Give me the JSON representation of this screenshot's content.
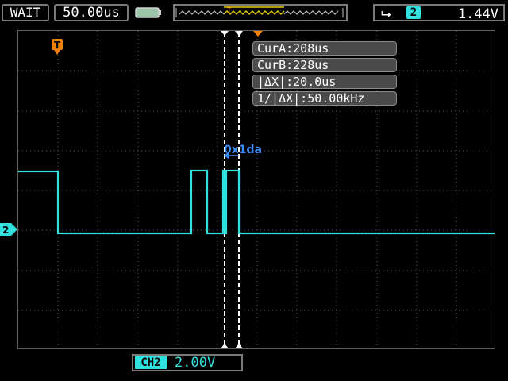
{
  "status": {
    "run_state": "WAIT",
    "timebase": "50.00us",
    "battery_icon": "battery-icon"
  },
  "trigger": {
    "slope_icon": "trigger-slope-icon",
    "source": "2",
    "level": "1.44V",
    "marker_label": "T"
  },
  "cursors": {
    "cur_a": "CurA:208us",
    "cur_b": "CurB:228us",
    "delta_x": "|ΔX|:20.0us",
    "inv_delta_x": "1/|ΔX|:50.00kHz"
  },
  "decode": {
    "value": "0x1da"
  },
  "channel": {
    "marker": "2",
    "tag": "CH2",
    "volts_per_div": "2.00V",
    "color": "#33e0e0"
  }
}
